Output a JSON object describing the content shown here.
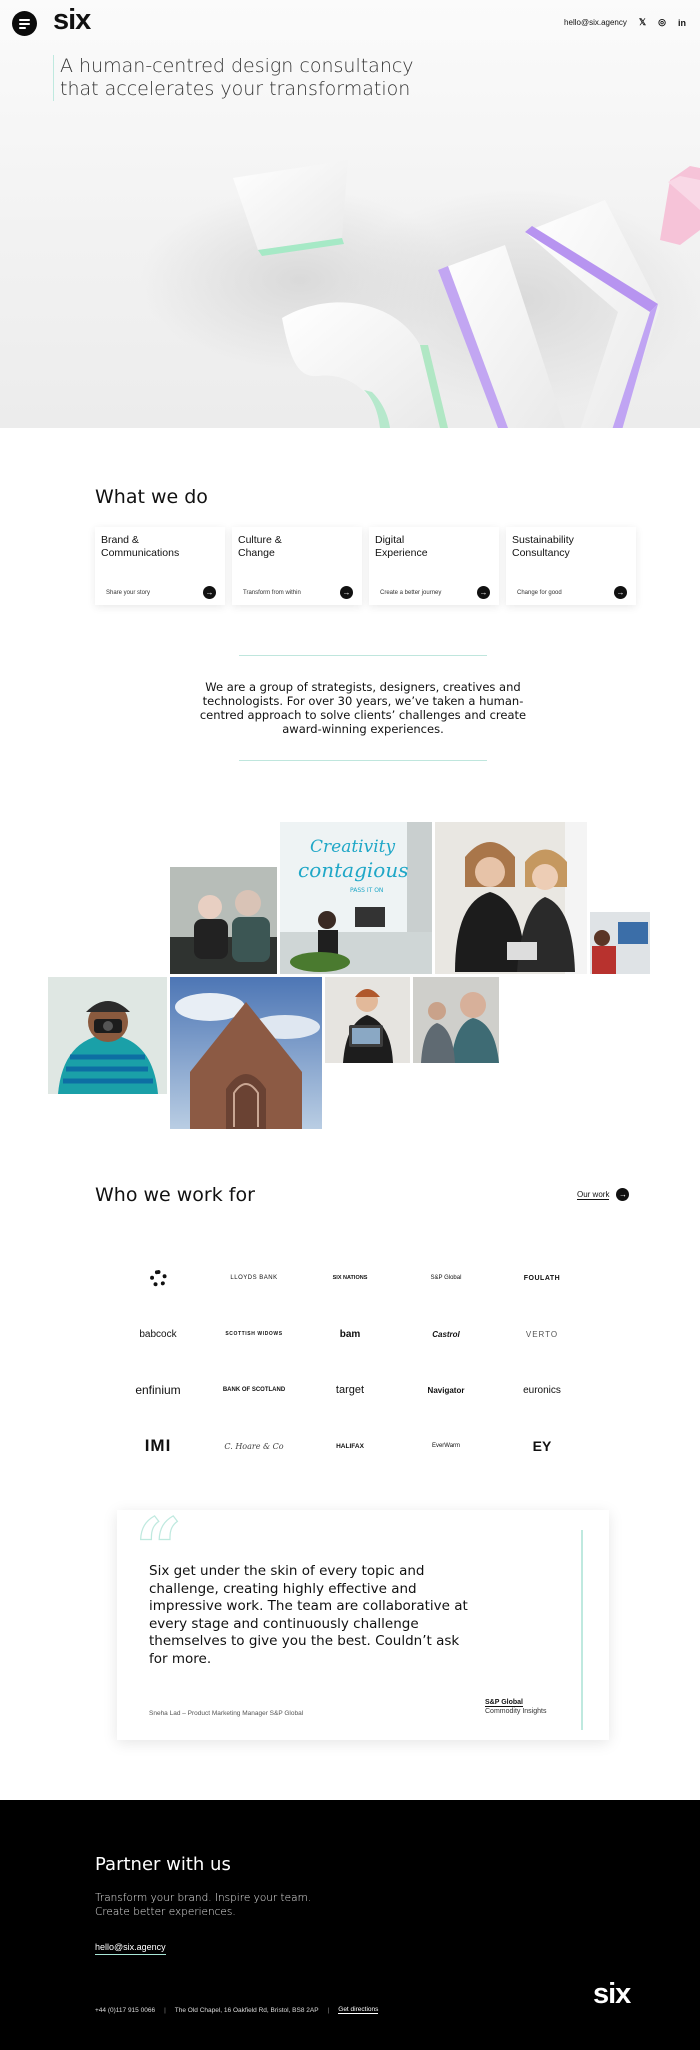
{
  "brand": {
    "logo": "six",
    "accent": "#bfe9df"
  },
  "header": {
    "email": "hello@six.agency",
    "social": [
      {
        "name": "twitter-icon",
        "glyph": "𝕏"
      },
      {
        "name": "instagram-icon",
        "glyph": "◎"
      },
      {
        "name": "linkedin-icon",
        "glyph": "in"
      }
    ]
  },
  "hero": {
    "title": "A human-centred design consultancy that accelerates your transformation"
  },
  "what_we_do": {
    "title": "What we do",
    "cards": [
      {
        "title": "Brand &\nCommunications",
        "sub": "Share your story"
      },
      {
        "title": "Culture &\nChange",
        "sub": "Transform from within"
      },
      {
        "title": "Digital\nExperience",
        "sub": "Create a better journey"
      },
      {
        "title": "Sustainability\nConsultancy",
        "sub": "Change for good"
      }
    ]
  },
  "about": "We are a group of strategists, designers, creatives and technologists. For over 30 years, we’ve taken a human-centred approach to solve clients’ challenges and create award-winning experiences.",
  "collage": {
    "neon_line1": "Creativity",
    "neon_line2": "contagious",
    "neon_line3": "PASS IT ON"
  },
  "clients": {
    "title": "Who we work for",
    "our_work": "Our work",
    "logos": [
      "bp",
      "LLOYDS BANK",
      "SIX NATIONS",
      "S&P Global",
      "FOULATH",
      "babcock",
      "SCOTTISH WIDOWS",
      "bam",
      "Castrol",
      "VERTO",
      "enfinium",
      "BANK OF SCOTLAND",
      "target",
      "Navigator",
      "euronics",
      "IMI",
      "C. Hoare & Co",
      "HALIFAX",
      "EverWarm",
      "EY"
    ]
  },
  "testimonial": {
    "quote": "Six get under the skin of every topic and challenge, creating highly effective and impressive work. The team are collaborative at every stage and continuously challenge themselves to give you the best. Couldn’t ask for more.",
    "author": "Sneha Lad – Product Marketing Manager S&P Global",
    "company": "S&P Global",
    "company_sub": "Commodity Insights"
  },
  "footer": {
    "title": "Partner with us",
    "text": "Transform your brand. Inspire your team.\nCreate better experiences.",
    "email": "hello@six.agency",
    "phone": "+44 (0)117 915 0066",
    "address": "The Old Chapel, 16 Oakfield Rd, Bristol, BS8 2AP",
    "directions": "Get directions",
    "logo": "six"
  }
}
